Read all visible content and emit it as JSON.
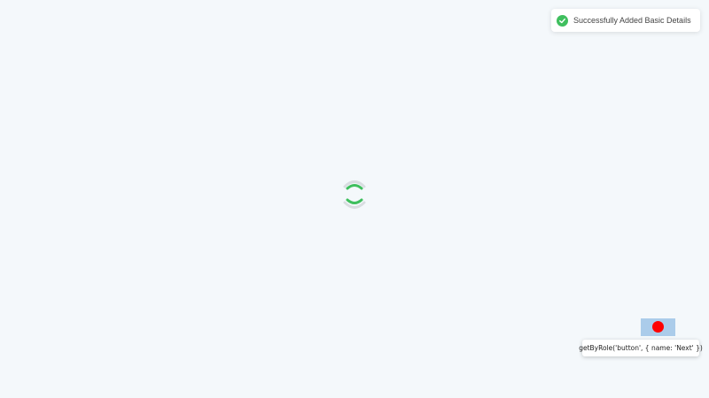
{
  "toast": {
    "icon": "check-circle-icon",
    "message": "Successfully Added Basic Details",
    "color": "#3fbf5e"
  },
  "loader": {
    "icon": "loading-spinner-icon",
    "color": "#3fbf5e"
  },
  "overlay": {
    "locator": "getByRole('button', { name: 'Next' })",
    "highlight_color": "#6fa8dc",
    "cursor_color": "#ff0000"
  }
}
